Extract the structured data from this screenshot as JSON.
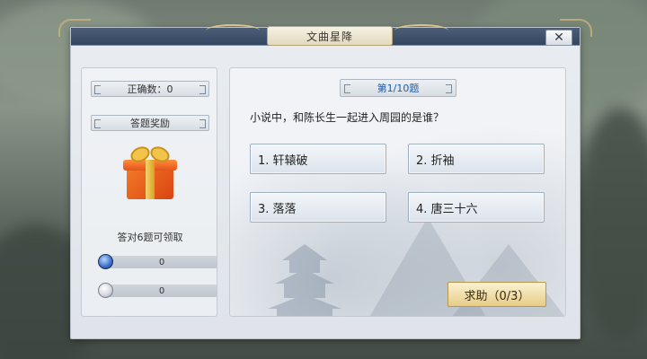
{
  "window": {
    "title": "文曲星降",
    "close_symbol": "✕"
  },
  "left": {
    "correct_label": "正确数：0",
    "reward_label": "答题奖励",
    "reward_hint": "答对6题可领取",
    "stats": [
      {
        "icon": "coin-icon",
        "value": "0"
      },
      {
        "icon": "silver-icon",
        "value": "0"
      }
    ]
  },
  "quiz": {
    "progress": "第1/10题",
    "question": "小说中，和陈长生一起进入周园的是谁？",
    "answers": [
      "1. 轩辕破",
      "2. 折袖",
      "3. 落落",
      "4. 唐三十六"
    ],
    "help_label": "求助（0/3）"
  },
  "colors": {
    "accent": "#1d5ba8",
    "title_bar": "#33455f",
    "help_button": "#e6cc86",
    "gift": "#e4541a"
  }
}
